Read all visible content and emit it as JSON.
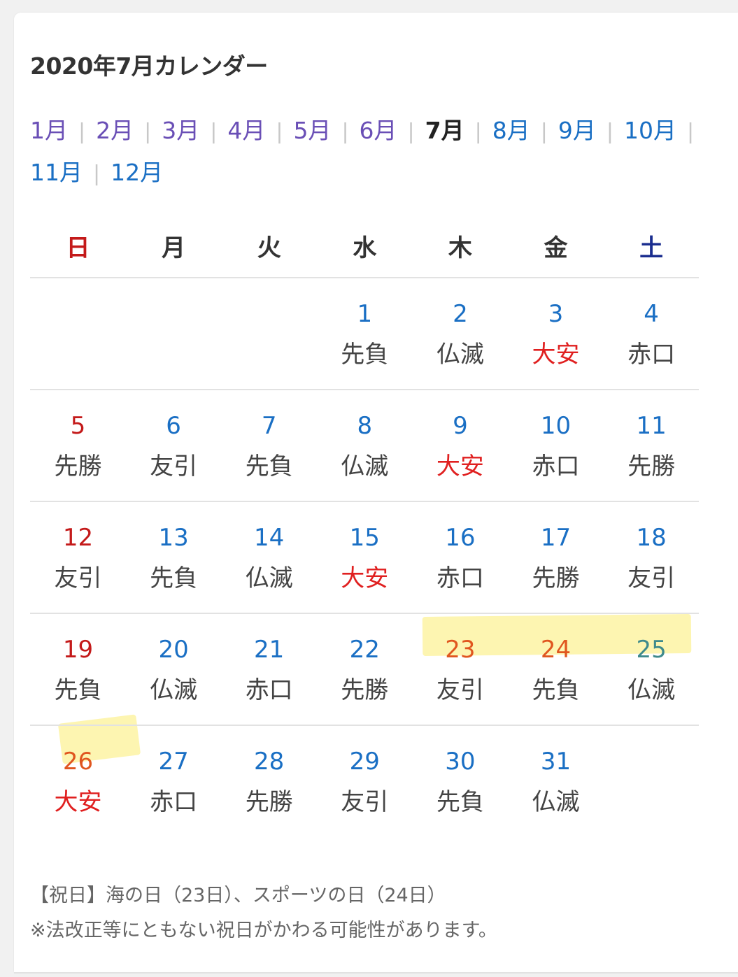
{
  "title": "2020年7月カレンダー",
  "months": [
    {
      "label": "1月",
      "state": "visited"
    },
    {
      "label": "2月",
      "state": "visited"
    },
    {
      "label": "3月",
      "state": "visited"
    },
    {
      "label": "4月",
      "state": "visited"
    },
    {
      "label": "5月",
      "state": "visited"
    },
    {
      "label": "6月",
      "state": "visited"
    },
    {
      "label": "7月",
      "state": "current"
    },
    {
      "label": "8月",
      "state": "link"
    },
    {
      "label": "9月",
      "state": "link"
    },
    {
      "label": "10月",
      "state": "link"
    },
    {
      "label": "11月",
      "state": "link"
    },
    {
      "label": "12月",
      "state": "link"
    }
  ],
  "weekdays": [
    "日",
    "月",
    "火",
    "水",
    "木",
    "金",
    "土"
  ],
  "weeks": [
    [
      null,
      null,
      null,
      {
        "day": "1",
        "rokuyo": "先負"
      },
      {
        "day": "2",
        "rokuyo": "仏滅"
      },
      {
        "day": "3",
        "rokuyo": "大安"
      },
      {
        "day": "4",
        "rokuyo": "赤口"
      }
    ],
    [
      {
        "day": "5",
        "rokuyo": "先勝"
      },
      {
        "day": "6",
        "rokuyo": "友引"
      },
      {
        "day": "7",
        "rokuyo": "先負"
      },
      {
        "day": "8",
        "rokuyo": "仏滅"
      },
      {
        "day": "9",
        "rokuyo": "大安"
      },
      {
        "day": "10",
        "rokuyo": "赤口"
      },
      {
        "day": "11",
        "rokuyo": "先勝"
      }
    ],
    [
      {
        "day": "12",
        "rokuyo": "友引"
      },
      {
        "day": "13",
        "rokuyo": "先負"
      },
      {
        "day": "14",
        "rokuyo": "仏滅"
      },
      {
        "day": "15",
        "rokuyo": "大安"
      },
      {
        "day": "16",
        "rokuyo": "赤口"
      },
      {
        "day": "17",
        "rokuyo": "先勝"
      },
      {
        "day": "18",
        "rokuyo": "友引"
      }
    ],
    [
      {
        "day": "19",
        "rokuyo": "先負"
      },
      {
        "day": "20",
        "rokuyo": "仏滅"
      },
      {
        "day": "21",
        "rokuyo": "赤口"
      },
      {
        "day": "22",
        "rokuyo": "先勝"
      },
      {
        "day": "23",
        "rokuyo": "友引",
        "holiday": true
      },
      {
        "day": "24",
        "rokuyo": "先負",
        "holiday": true
      },
      {
        "day": "25",
        "rokuyo": "仏滅",
        "marked": true
      }
    ],
    [
      {
        "day": "26",
        "rokuyo": "大安",
        "marked": true
      },
      {
        "day": "27",
        "rokuyo": "赤口"
      },
      {
        "day": "28",
        "rokuyo": "先勝"
      },
      {
        "day": "29",
        "rokuyo": "友引"
      },
      {
        "day": "30",
        "rokuyo": "先負"
      },
      {
        "day": "31",
        "rokuyo": "仏滅"
      },
      null
    ]
  ],
  "holiday_note": "【祝日】海の日（23日）、スポーツの日（24日）",
  "disclaimer": "※法改正等にともない祝日がかわる可能性があります。",
  "colors": {
    "sunday": "#c41a1a",
    "saturday_header": "#1a2d8f",
    "weekday_number": "#1a6fc4",
    "holiday_number": "#e0561f",
    "taian": "#e02020",
    "highlighter": "#fdf3a3"
  }
}
